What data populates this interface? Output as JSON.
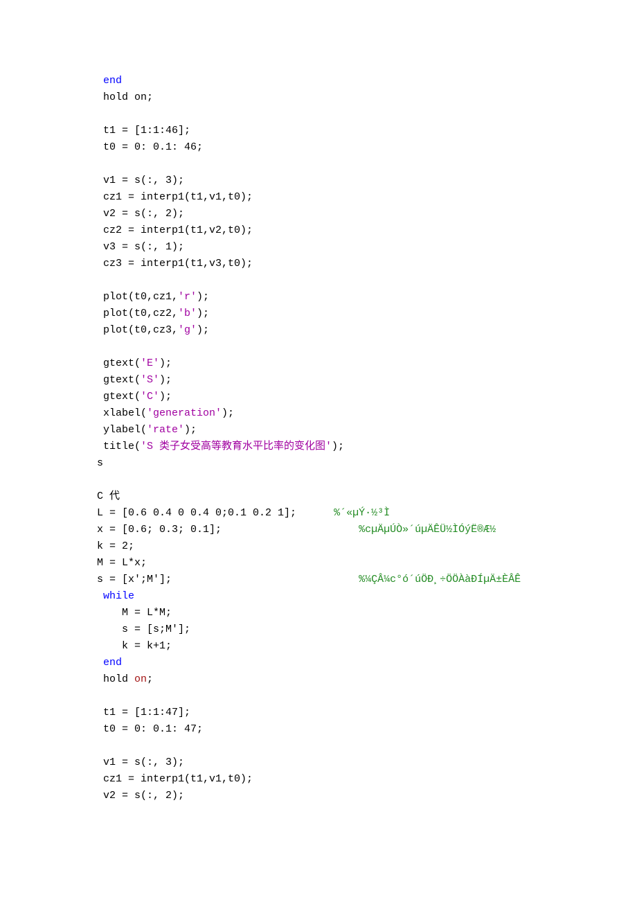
{
  "lines": [
    {
      "segments": [
        {
          "text": " ",
          "cls": ""
        },
        {
          "text": "end",
          "cls": "kw-blue"
        }
      ]
    },
    {
      "segments": [
        {
          "text": " hold on;",
          "cls": ""
        }
      ]
    },
    {
      "segments": [
        {
          "text": "",
          "cls": ""
        }
      ]
    },
    {
      "segments": [
        {
          "text": " t1 = [1:1:46];",
          "cls": ""
        }
      ]
    },
    {
      "segments": [
        {
          "text": " t0 = 0: 0.1: 46;",
          "cls": ""
        }
      ]
    },
    {
      "segments": [
        {
          "text": "",
          "cls": ""
        }
      ]
    },
    {
      "segments": [
        {
          "text": " v1 = s(:, 3);",
          "cls": ""
        }
      ]
    },
    {
      "segments": [
        {
          "text": " cz1 = interp1(t1,v1,t0);",
          "cls": ""
        }
      ]
    },
    {
      "segments": [
        {
          "text": " v2 = s(:, 2);",
          "cls": ""
        }
      ]
    },
    {
      "segments": [
        {
          "text": " cz2 = interp1(t1,v2,t0);",
          "cls": ""
        }
      ]
    },
    {
      "segments": [
        {
          "text": " v3 = s(:, 1);",
          "cls": ""
        }
      ]
    },
    {
      "segments": [
        {
          "text": " cz3 = interp1(t1,v3,t0);",
          "cls": ""
        }
      ]
    },
    {
      "segments": [
        {
          "text": "",
          "cls": ""
        }
      ]
    },
    {
      "segments": [
        {
          "text": " plot(t0,cz1,",
          "cls": ""
        },
        {
          "text": "'r'",
          "cls": "str"
        },
        {
          "text": ");",
          "cls": ""
        }
      ]
    },
    {
      "segments": [
        {
          "text": " plot(t0,cz2,",
          "cls": ""
        },
        {
          "text": "'b'",
          "cls": "str"
        },
        {
          "text": ");",
          "cls": ""
        }
      ]
    },
    {
      "segments": [
        {
          "text": " plot(t0,cz3,",
          "cls": ""
        },
        {
          "text": "'g'",
          "cls": "str"
        },
        {
          "text": ");",
          "cls": ""
        }
      ]
    },
    {
      "segments": [
        {
          "text": "",
          "cls": ""
        }
      ]
    },
    {
      "segments": [
        {
          "text": " gtext(",
          "cls": ""
        },
        {
          "text": "'E'",
          "cls": "str"
        },
        {
          "text": ");",
          "cls": ""
        }
      ]
    },
    {
      "segments": [
        {
          "text": " gtext(",
          "cls": ""
        },
        {
          "text": "'S'",
          "cls": "str"
        },
        {
          "text": ");",
          "cls": ""
        }
      ]
    },
    {
      "segments": [
        {
          "text": " gtext(",
          "cls": ""
        },
        {
          "text": "'C'",
          "cls": "str"
        },
        {
          "text": ");",
          "cls": ""
        }
      ]
    },
    {
      "segments": [
        {
          "text": " xlabel(",
          "cls": ""
        },
        {
          "text": "'generation'",
          "cls": "str"
        },
        {
          "text": ");",
          "cls": ""
        }
      ]
    },
    {
      "segments": [
        {
          "text": " ylabel(",
          "cls": ""
        },
        {
          "text": "'rate'",
          "cls": "str"
        },
        {
          "text": ");",
          "cls": ""
        }
      ]
    },
    {
      "segments": [
        {
          "text": " title(",
          "cls": ""
        },
        {
          "text": "'S 类子女受高等教育水平比率的变化图'",
          "cls": "str"
        },
        {
          "text": ");",
          "cls": ""
        }
      ]
    },
    {
      "segments": [
        {
          "text": "s",
          "cls": ""
        }
      ]
    },
    {
      "segments": [
        {
          "text": "",
          "cls": ""
        }
      ]
    },
    {
      "segments": [
        {
          "text": "C 代",
          "cls": ""
        }
      ]
    },
    {
      "segments": [
        {
          "text": "L = [0.6 0.4 0 0.4 0;0.1 0.2 1];      ",
          "cls": ""
        },
        {
          "text": "%´«µÝ·½³Ì",
          "cls": "comment"
        }
      ]
    },
    {
      "segments": [
        {
          "text": "x = [0.6; 0.3; 0.1];                      ",
          "cls": ""
        },
        {
          "text": "%cµÄµÚÒ»´úµÄÊÜ½ÌÓýË®Æ½",
          "cls": "comment"
        }
      ]
    },
    {
      "segments": [
        {
          "text": "k = 2;",
          "cls": ""
        }
      ]
    },
    {
      "segments": [
        {
          "text": "M = L*x;",
          "cls": ""
        }
      ]
    },
    {
      "segments": [
        {
          "text": "s = [x';M'];                              ",
          "cls": ""
        },
        {
          "text": "%¼ÇÂ¼c°ó´úÖÐ¸÷ÖÖÀàÐÍµÄ±ÈÂÊ",
          "cls": "comment"
        }
      ]
    },
    {
      "segments": [
        {
          "text": " ",
          "cls": ""
        },
        {
          "text": "while",
          "cls": "kw-blue"
        }
      ]
    },
    {
      "segments": [
        {
          "text": "    M = L*M;",
          "cls": ""
        }
      ]
    },
    {
      "segments": [
        {
          "text": "    s = [s;M'];",
          "cls": ""
        }
      ]
    },
    {
      "segments": [
        {
          "text": "    k = k+1;",
          "cls": ""
        }
      ]
    },
    {
      "segments": [
        {
          "text": " ",
          "cls": ""
        },
        {
          "text": "end",
          "cls": "kw-blue"
        }
      ]
    },
    {
      "segments": [
        {
          "text": " hold ",
          "cls": ""
        },
        {
          "text": "on",
          "cls": "kw-red"
        },
        {
          "text": ";",
          "cls": ""
        }
      ]
    },
    {
      "segments": [
        {
          "text": "",
          "cls": ""
        }
      ]
    },
    {
      "segments": [
        {
          "text": " t1 = [1:1:47];",
          "cls": ""
        }
      ]
    },
    {
      "segments": [
        {
          "text": " t0 = 0: 0.1: 47;",
          "cls": ""
        }
      ]
    },
    {
      "segments": [
        {
          "text": "",
          "cls": ""
        }
      ]
    },
    {
      "segments": [
        {
          "text": " v1 = s(:, 3);",
          "cls": ""
        }
      ]
    },
    {
      "segments": [
        {
          "text": " cz1 = interp1(t1,v1,t0);",
          "cls": ""
        }
      ]
    },
    {
      "segments": [
        {
          "text": " v2 = s(:, 2);",
          "cls": ""
        }
      ]
    }
  ]
}
